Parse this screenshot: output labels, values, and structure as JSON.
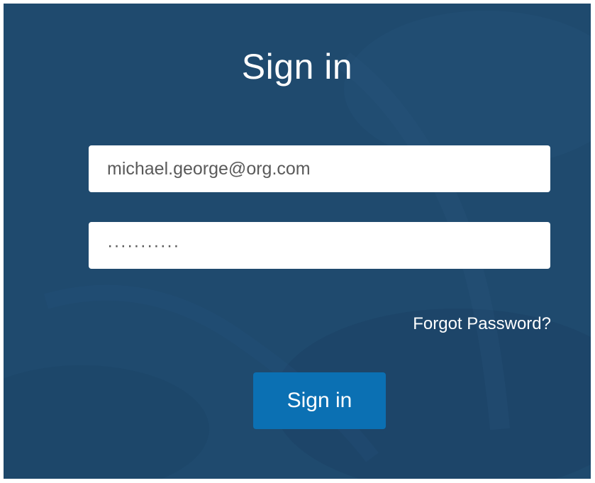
{
  "page": {
    "title": "Sign in"
  },
  "form": {
    "email_value": "michael.george@org.com",
    "password_value": "···········",
    "forgot_password_label": "Forgot Password?",
    "submit_label": "Sign in"
  },
  "colors": {
    "panel_background": "#1f4a6e",
    "button_background": "#0b70b3",
    "text": "#ffffff"
  }
}
